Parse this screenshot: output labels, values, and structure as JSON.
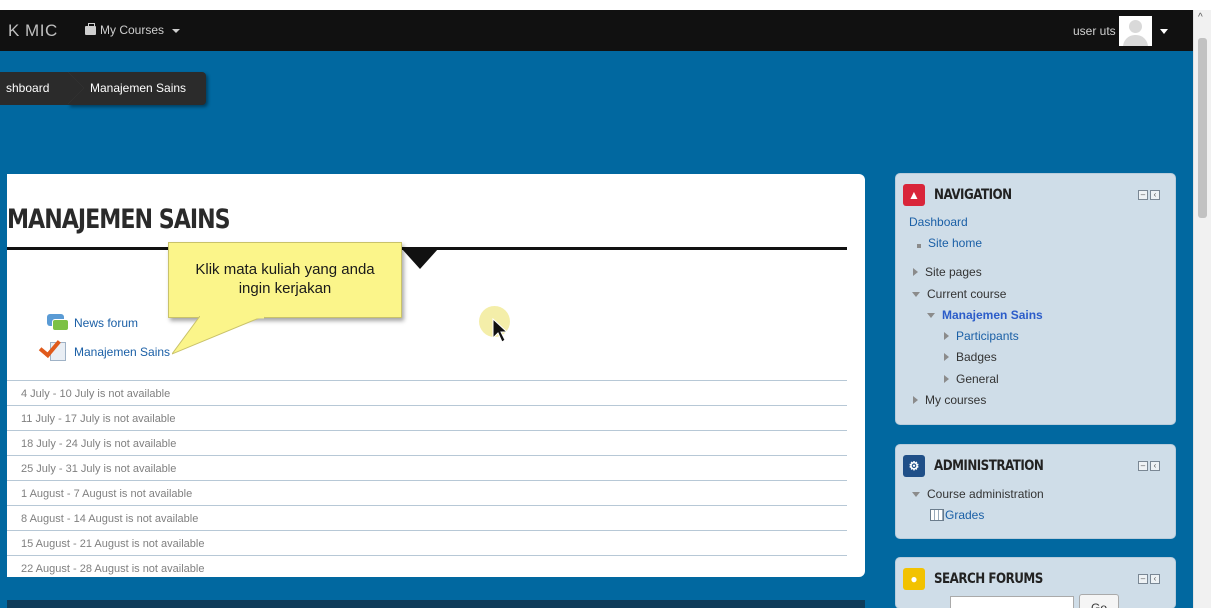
{
  "navbar": {
    "brand": "K MIC",
    "my_courses_label": "My Courses",
    "username": "user uts"
  },
  "breadcrumb": {
    "items": [
      "shboard",
      "Manajemen Sains"
    ]
  },
  "course": {
    "title": "MANAJEMEN SAINS",
    "activities": [
      {
        "label": "News forum",
        "icon": "forum-icon"
      },
      {
        "label": "Manajemen Sains",
        "icon": "assignment-icon"
      }
    ],
    "weeks": [
      "4 July - 10 July is not available",
      "11 July - 17 July is not available",
      "18 July - 24 July is not available",
      "25 July - 31 July is not available",
      "1 August - 7 August is not available",
      "8 August - 14 August is not available",
      "15 August - 21 August is not available",
      "22 August - 28 August is not available"
    ]
  },
  "callout": {
    "line1": "Klik mata kuliah yang anda",
    "line2": "ingin kerjakan"
  },
  "navigation_block": {
    "title": "NAVIGATION",
    "dashboard": "Dashboard",
    "site_home": "Site home",
    "site_pages": "Site pages",
    "current_course": "Current course",
    "course_name": "Manajemen Sains",
    "participants": "Participants",
    "badges": "Badges",
    "general": "General",
    "my_courses": "My courses"
  },
  "admin_block": {
    "title": "ADMINISTRATION",
    "course_admin": "Course administration",
    "grades": "Grades"
  },
  "search_block": {
    "title": "SEARCH FORUMS",
    "go_label": "Go"
  },
  "colors": {
    "page_bg": "#0168a0",
    "navbar_bg": "#111111",
    "block_bg": "#cfdde8",
    "callout_bg": "#fbf58a"
  }
}
